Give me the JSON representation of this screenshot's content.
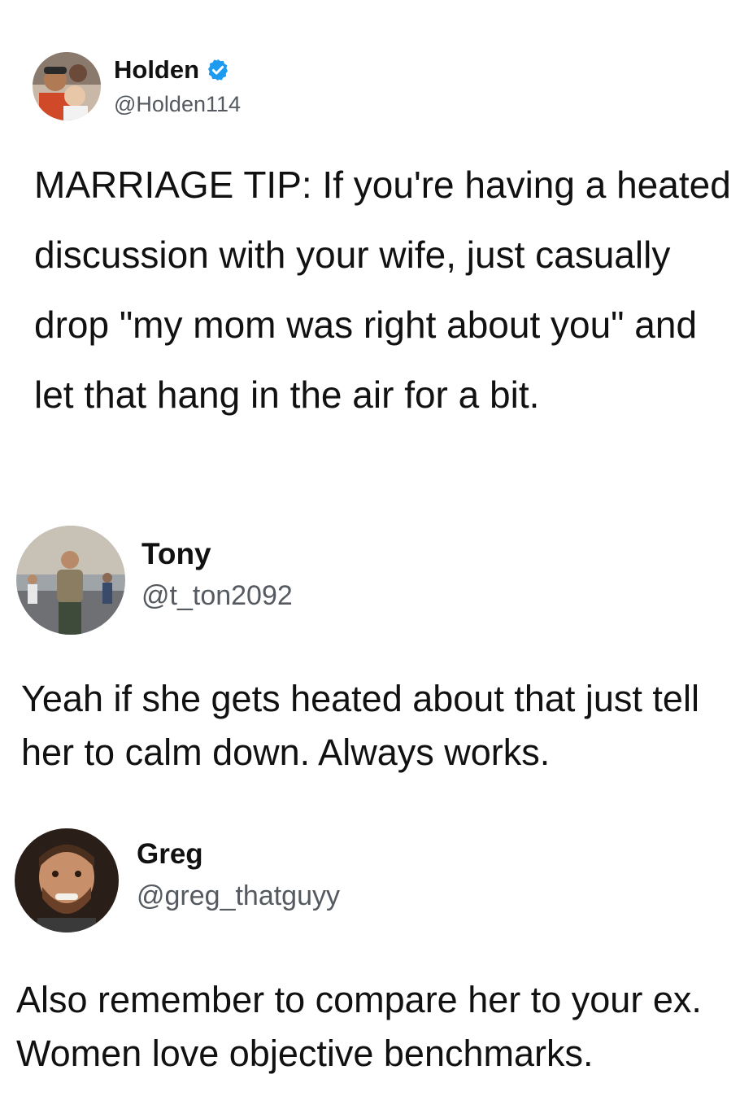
{
  "colors": {
    "background": "#ffffff",
    "text": "#111111",
    "handle": "#555a60",
    "verified_badge": "#1d9bf0"
  },
  "tweets": [
    {
      "display_name": "Holden",
      "handle": "@Holden114",
      "verified": true,
      "avatar_icon": "avatar-photo-adult-and-child",
      "text": "MARRIAGE TIP: If you're having a heated discussion with your wife, just casually drop \"my mom was right about you\" and let that hang in the air for a bit."
    },
    {
      "display_name": "Tony",
      "handle": "@t_ton2092",
      "verified": false,
      "avatar_icon": "avatar-photo-man-on-street",
      "text": "Yeah if she gets heated about that just tell her to calm down. Always works."
    },
    {
      "display_name": "Greg",
      "handle": "@greg_thatguyy",
      "verified": false,
      "avatar_icon": "avatar-photo-smiling-man",
      "text": "Also remember to compare her to your ex. Women love objective benchmarks."
    }
  ]
}
